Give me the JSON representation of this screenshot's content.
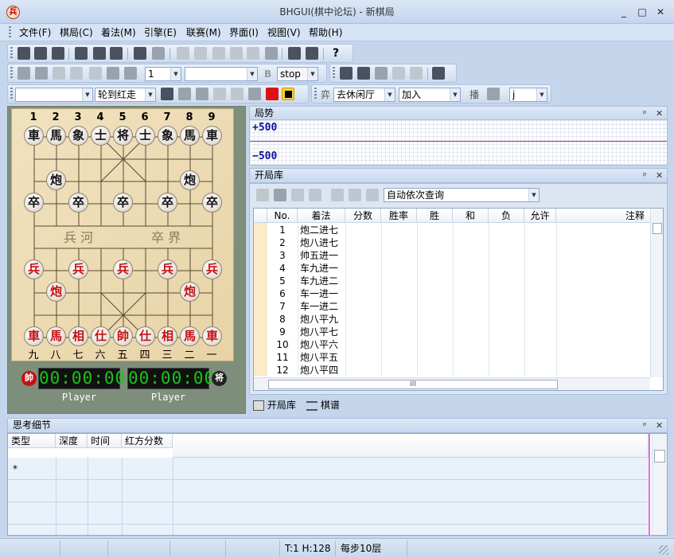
{
  "window": {
    "title": "BHGUI(棋中论坛) - 新棋局",
    "icon_char": "兵",
    "min": "_",
    "max": "□",
    "close": "✕"
  },
  "menu": [
    "文件(F)",
    "棋局(C)",
    "着法(M)",
    "引擎(E)",
    "联赛(M)",
    "界面(I)",
    "视图(V)",
    "帮助(H)"
  ],
  "toolbar2": {
    "combo1": "1",
    "combo2": "",
    "b_label": "B",
    "stop": "stop"
  },
  "toolbar3": {
    "combo_blank": "",
    "turn": "轮到红走",
    "yi": "弈",
    "lounge": "去休闲厅",
    "join": "加入",
    "bo": "播",
    "j": "j"
  },
  "board": {
    "top_coords": [
      "1",
      "2",
      "3",
      "4",
      "5",
      "6",
      "7",
      "8",
      "9"
    ],
    "bottom_coords": [
      "九",
      "八",
      "七",
      "六",
      "五",
      "四",
      "三",
      "二",
      "一"
    ],
    "river_left": "兵 河",
    "river_right": "卒 界",
    "black_row0": [
      "車",
      "馬",
      "象",
      "士",
      "将",
      "士",
      "象",
      "馬",
      "車"
    ],
    "black_cannons": [
      "炮",
      "炮"
    ],
    "black_pawns": [
      "卒",
      "卒",
      "卒",
      "卒",
      "卒"
    ],
    "red_pawns": [
      "兵",
      "兵",
      "兵",
      "兵",
      "兵"
    ],
    "red_cannons": [
      "炮",
      "炮"
    ],
    "red_row9": [
      "車",
      "馬",
      "相",
      "仕",
      "帥",
      "仕",
      "相",
      "馬",
      "車"
    ]
  },
  "clocks": {
    "red_badge": "帥",
    "black_badge": "将",
    "red_time": "00:00:00",
    "black_time": "00:00:00",
    "red_player": "Player",
    "black_player": "Player"
  },
  "eval": {
    "title": "局势",
    "top": "+500",
    "bottom": "−500"
  },
  "book": {
    "title": "开局库",
    "query_mode": "自动依次查询",
    "headers": [
      "No.",
      "着法",
      "分数",
      "胜率",
      "胜",
      "和",
      "负",
      "允许",
      "注释"
    ],
    "rows": [
      [
        "1",
        "炮二进七"
      ],
      [
        "2",
        "炮八进七"
      ],
      [
        "3",
        "帅五进一"
      ],
      [
        "4",
        "车九进一"
      ],
      [
        "5",
        "车九进二"
      ],
      [
        "6",
        "车一进一"
      ],
      [
        "7",
        "车一进二"
      ],
      [
        "8",
        "炮八平九"
      ],
      [
        "9",
        "炮八平七"
      ],
      [
        "10",
        "炮八平六"
      ],
      [
        "11",
        "炮八平五"
      ],
      [
        "12",
        "炮八平四"
      ]
    ],
    "hscroll_mid": "III"
  },
  "tabs": {
    "book": "开局库",
    "notation": "棋谱"
  },
  "think": {
    "title": "思考细节",
    "headers": [
      "类型",
      "深度",
      "时间",
      "红方分数",
      ""
    ],
    "row1_type": "*"
  },
  "status": {
    "time": "T:1 H:128",
    "mode": "每步10层"
  }
}
